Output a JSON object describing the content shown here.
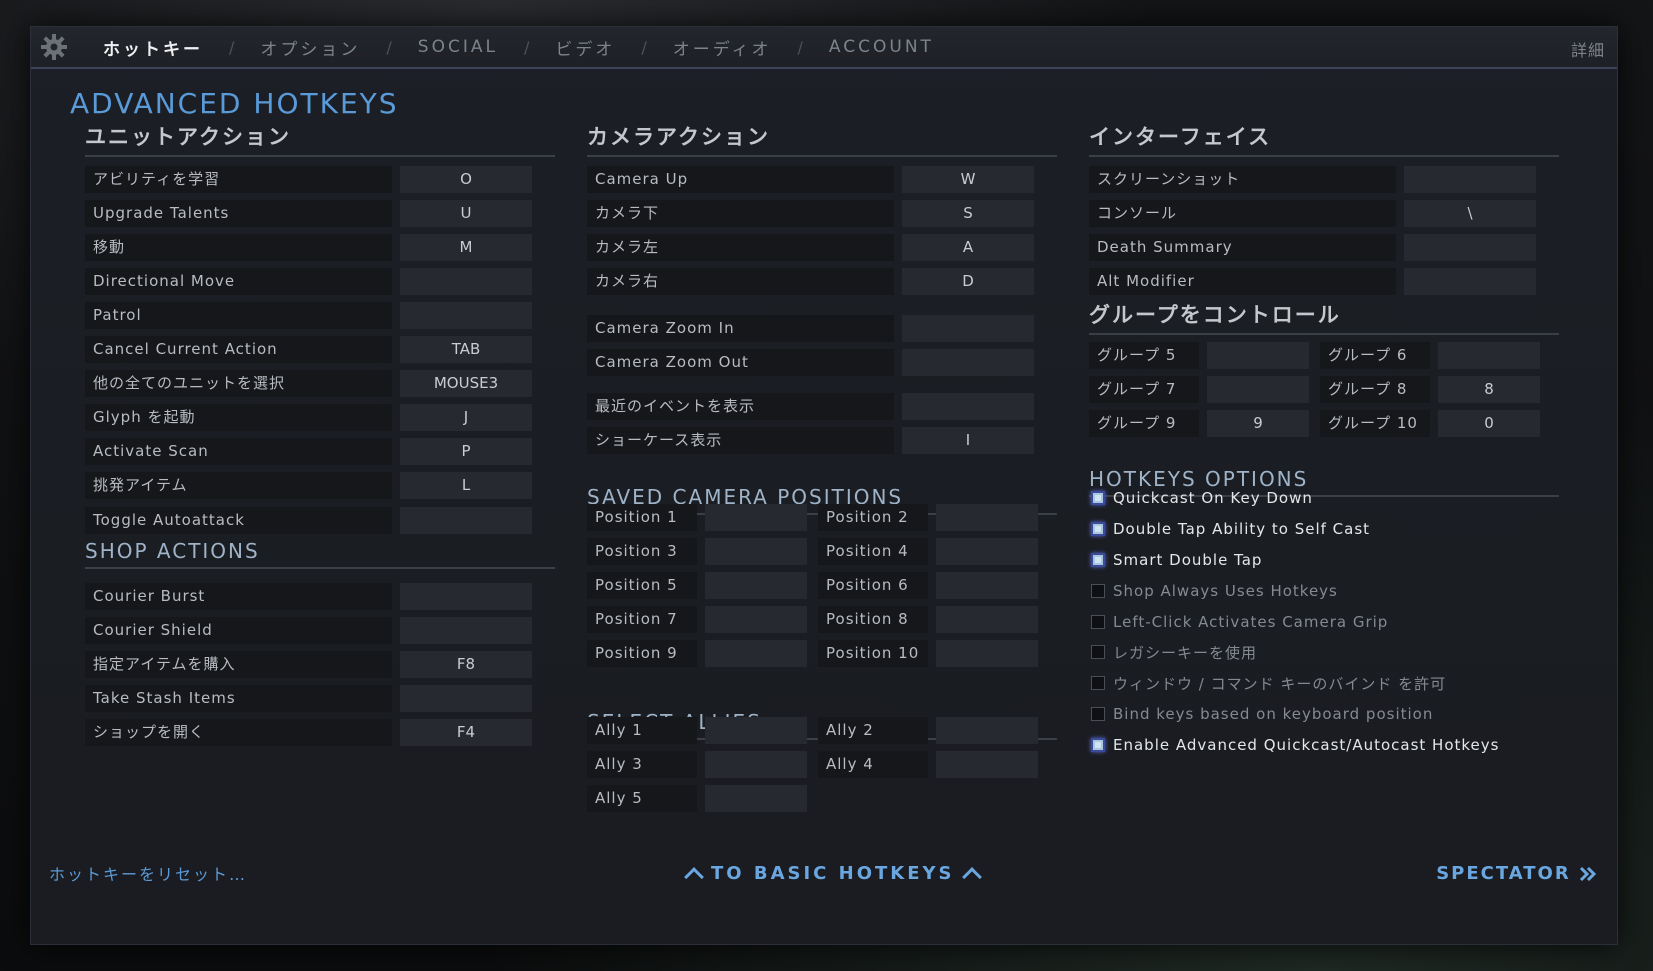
{
  "tabs": [
    "ホットキー",
    "オプション",
    "SOCIAL",
    "ビデオ",
    "オーディオ",
    "ACCOUNT"
  ],
  "separator": "/",
  "detail_label": "詳細",
  "page_title": "ADVANCED HOTKEYS",
  "unit_actions": {
    "title": "ユニットアクション",
    "rows": [
      {
        "label": "アビリティを学習",
        "key": "O"
      },
      {
        "label": "Upgrade Talents",
        "key": "U"
      },
      {
        "label": "移動",
        "key": "M"
      },
      {
        "label": "Directional Move",
        "key": ""
      },
      {
        "label": "Patrol",
        "key": ""
      },
      {
        "label": "Cancel Current Action",
        "key": "TAB"
      },
      {
        "label": "他の全てのユニットを選択",
        "key": "MOUSE3"
      },
      {
        "label": "Glyph を起動",
        "key": "J"
      },
      {
        "label": "Activate Scan",
        "key": "P"
      },
      {
        "label": "挑発アイテム",
        "key": "L"
      },
      {
        "label": "Toggle Autoattack",
        "key": ""
      }
    ]
  },
  "shop_actions": {
    "title": "SHOP ACTIONS",
    "rows": [
      {
        "label": "Courier Burst",
        "key": ""
      },
      {
        "label": "Courier Shield",
        "key": ""
      },
      {
        "label": "指定アイテムを購入",
        "key": "F8"
      },
      {
        "label": "Take Stash Items",
        "key": ""
      },
      {
        "label": "ショップを開く",
        "key": "F4"
      }
    ]
  },
  "camera_actions": {
    "title": "カメラアクション",
    "rows": [
      {
        "label": "Camera Up",
        "key": "W"
      },
      {
        "label": "カメラ下",
        "key": "S"
      },
      {
        "label": "カメラ左",
        "key": "A"
      },
      {
        "label": "カメラ右",
        "key": "D"
      },
      {
        "label": "Camera Zoom In",
        "key": ""
      },
      {
        "label": "Camera Zoom Out",
        "key": ""
      },
      {
        "label": "最近のイベントを表示",
        "key": ""
      },
      {
        "label": "ショーケース表示",
        "key": "I"
      }
    ]
  },
  "saved_camera": {
    "title": "SAVED CAMERA POSITIONS",
    "items": [
      {
        "label": "Position 1",
        "key": ""
      },
      {
        "label": "Position 2",
        "key": ""
      },
      {
        "label": "Position 3",
        "key": ""
      },
      {
        "label": "Position 4",
        "key": ""
      },
      {
        "label": "Position 5",
        "key": ""
      },
      {
        "label": "Position 6",
        "key": ""
      },
      {
        "label": "Position 7",
        "key": ""
      },
      {
        "label": "Position 8",
        "key": ""
      },
      {
        "label": "Position 9",
        "key": ""
      },
      {
        "label": "Position 10",
        "key": ""
      }
    ]
  },
  "select_allies": {
    "title": "SELECT ALLIES",
    "items": [
      {
        "label": "Ally 1",
        "key": ""
      },
      {
        "label": "Ally 2",
        "key": ""
      },
      {
        "label": "Ally 3",
        "key": ""
      },
      {
        "label": "Ally 4",
        "key": ""
      },
      {
        "label": "Ally 5",
        "key": ""
      }
    ]
  },
  "interface": {
    "title": "インターフェイス",
    "rows": [
      {
        "label": "スクリーンショット",
        "key": ""
      },
      {
        "label": "コンソール",
        "key": "\\"
      },
      {
        "label": "Death Summary",
        "key": ""
      },
      {
        "label": "Alt Modifier",
        "key": ""
      }
    ]
  },
  "control_groups": {
    "title": "グループをコントロール",
    "items": [
      {
        "label": "グループ 5",
        "key": ""
      },
      {
        "label": "グループ 6",
        "key": ""
      },
      {
        "label": "グループ 7",
        "key": ""
      },
      {
        "label": "グループ 8",
        "key": "8"
      },
      {
        "label": "グループ 9",
        "key": "9"
      },
      {
        "label": "グループ 10",
        "key": "0"
      }
    ]
  },
  "hotkey_options": {
    "title": "HOTKEYS OPTIONS",
    "items": [
      {
        "label": "Quickcast On Key Down",
        "checked": true
      },
      {
        "label": "Double Tap Ability to Self Cast",
        "checked": true
      },
      {
        "label": "Smart Double Tap",
        "checked": true
      },
      {
        "label": "Shop Always Uses Hotkeys",
        "checked": false
      },
      {
        "label": "Left-Click Activates Camera Grip",
        "checked": false
      },
      {
        "label": "レガシーキーを使用",
        "checked": false
      },
      {
        "label": "ウィンドウ / コマンド キーのバインド を許可",
        "checked": false
      },
      {
        "label": "Bind keys based on keyboard position",
        "checked": false
      },
      {
        "label": "Enable Advanced Quickcast/Autocast Hotkeys",
        "checked": true
      }
    ]
  },
  "footer": {
    "reset_label": "ホットキーをリセット…",
    "basic_label": "TO BASIC HOTKEYS",
    "spectator_label": "SPECTATOR"
  },
  "colors": {
    "accent": "#5a9ad8",
    "panel": "#1b1e24",
    "key_bg": "#26292f",
    "label_bg": "#15171b"
  },
  "icons": {
    "settings": "gear-icon",
    "spectator": "double-chevron-right-icon",
    "basic": "chevron-up-icon"
  }
}
